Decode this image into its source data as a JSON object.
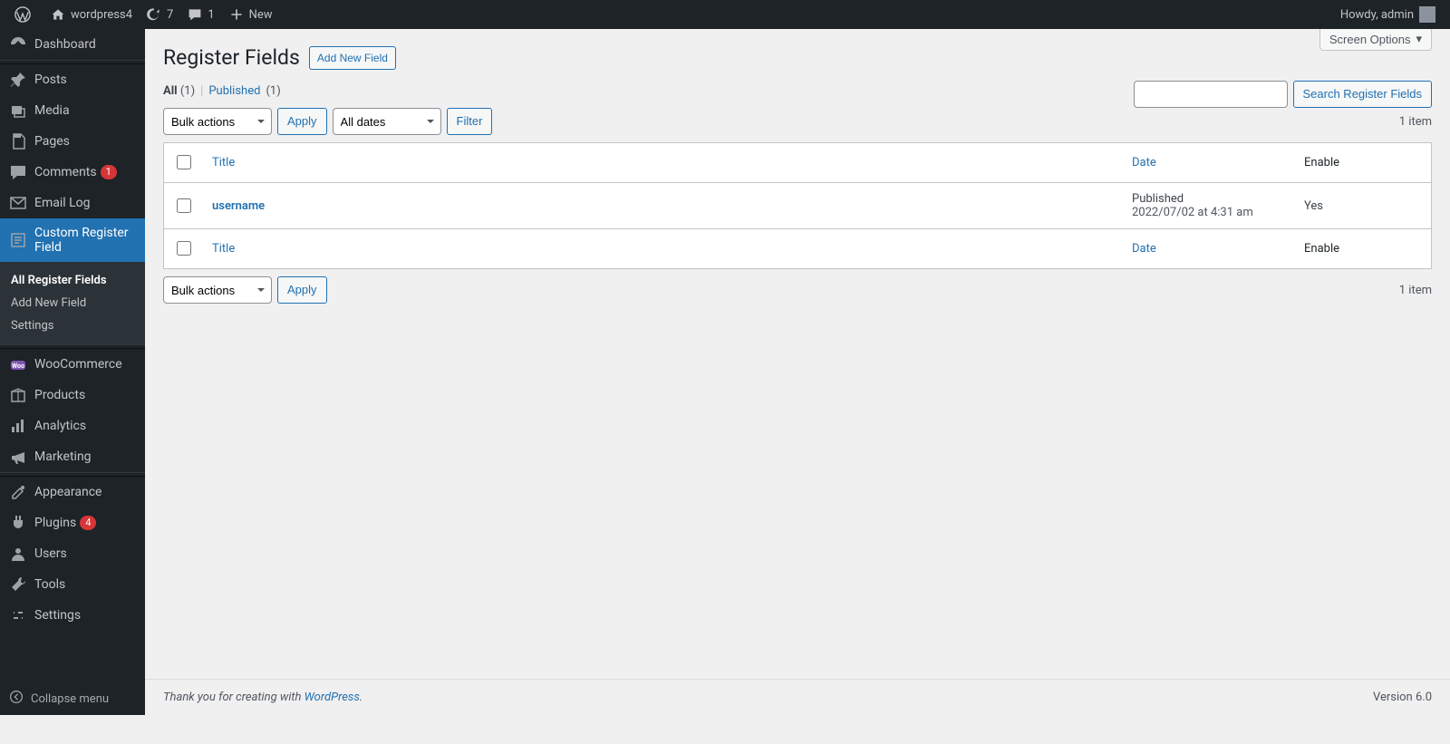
{
  "adminbar": {
    "site_name": "wordpress4",
    "updates_count": "7",
    "comments_count": "1",
    "new_label": "New",
    "howdy": "Howdy, admin"
  },
  "sidebar": {
    "items": [
      {
        "id": "dashboard",
        "label": "Dashboard",
        "icon": "dash"
      },
      {
        "id": "posts",
        "label": "Posts",
        "icon": "pin"
      },
      {
        "id": "media",
        "label": "Media",
        "icon": "media"
      },
      {
        "id": "pages",
        "label": "Pages",
        "icon": "page"
      },
      {
        "id": "comments",
        "label": "Comments",
        "icon": "comment",
        "badge": "1"
      },
      {
        "id": "emaillog",
        "label": "Email Log",
        "icon": "mail"
      },
      {
        "id": "crf",
        "label": "Custom Register Field",
        "icon": "form",
        "current": true
      },
      {
        "id": "woo",
        "label": "WooCommerce",
        "icon": "woo"
      },
      {
        "id": "products",
        "label": "Products",
        "icon": "box"
      },
      {
        "id": "analytics",
        "label": "Analytics",
        "icon": "bars"
      },
      {
        "id": "marketing",
        "label": "Marketing",
        "icon": "mega"
      },
      {
        "id": "appearance",
        "label": "Appearance",
        "icon": "brush"
      },
      {
        "id": "plugins",
        "label": "Plugins",
        "icon": "plug",
        "badge": "4"
      },
      {
        "id": "users",
        "label": "Users",
        "icon": "user"
      },
      {
        "id": "tools",
        "label": "Tools",
        "icon": "tool"
      },
      {
        "id": "settings",
        "label": "Settings",
        "icon": "settings"
      }
    ],
    "submenu": [
      {
        "label": "All Register Fields",
        "active": true
      },
      {
        "label": "Add New Field"
      },
      {
        "label": "Settings"
      }
    ],
    "collapse": "Collapse menu"
  },
  "page": {
    "screen_options": "Screen Options",
    "title": "Register Fields",
    "add_new": "Add New Field",
    "views": {
      "all_label": "All",
      "all_count": "(1)",
      "published_label": "Published",
      "published_count": "(1)"
    },
    "search_button": "Search Register Fields",
    "bulk_label": "Bulk actions",
    "apply_label": "Apply",
    "all_dates": "All dates",
    "filter_label": "Filter",
    "item_count": "1 item",
    "columns": {
      "title": "Title",
      "date": "Date",
      "enable": "Enable"
    },
    "rows": [
      {
        "title": "username",
        "date_status": "Published",
        "date_line": "2022/07/02 at 4:31 am",
        "enable": "Yes"
      }
    ]
  },
  "footer": {
    "thank_you": "Thank you for creating with ",
    "wp": "WordPress",
    "period": ".",
    "version": "Version 6.0"
  }
}
